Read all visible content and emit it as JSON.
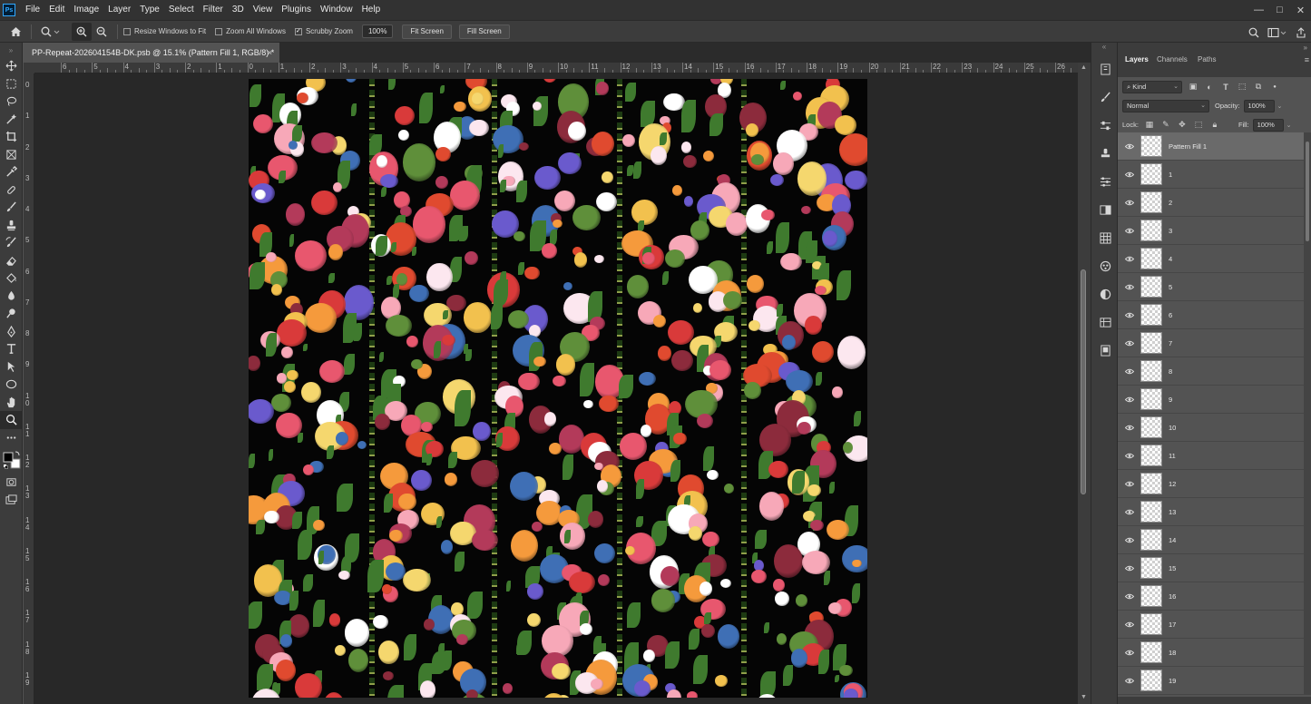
{
  "app": {
    "logo": "Ps",
    "menu": [
      "File",
      "Edit",
      "Image",
      "Layer",
      "Type",
      "Select",
      "Filter",
      "3D",
      "View",
      "Plugins",
      "Window",
      "Help"
    ],
    "window_controls": [
      "—",
      "□",
      "✕"
    ]
  },
  "options_bar": {
    "resize_windows_label": "Resize Windows to Fit",
    "zoom_all_label": "Zoom All Windows",
    "scrubby_zoom_label": "Scrubby Zoom",
    "scrubby_checked": "✓",
    "zoom_value": "100%",
    "fit_screen": "Fit Screen",
    "fill_screen": "Fill Screen"
  },
  "document": {
    "tab_title": "PP-Repeat-202604154B-DK.psb @ 15.1% (Pattern Fill 1, RGB/8) *",
    "close": "×"
  },
  "rulers": {
    "top": [
      "6",
      "5",
      "4",
      "3",
      "2",
      "1",
      "0",
      "1",
      "2",
      "3",
      "4",
      "5",
      "6",
      "7",
      "8",
      "9",
      "10",
      "11",
      "12",
      "13",
      "14",
      "15",
      "16",
      "17",
      "18",
      "19",
      "20",
      "21",
      "22",
      "23",
      "24",
      "25",
      "26"
    ],
    "left": [
      "0",
      "1",
      "2",
      "3",
      "4",
      "5",
      "6",
      "7",
      "8",
      "9",
      "10",
      "11",
      "12",
      "13",
      "14",
      "15",
      "16",
      "17",
      "18",
      "19"
    ]
  },
  "layers_panel": {
    "tabs": [
      "Layers",
      "Channels",
      "Paths"
    ],
    "filter_kind": "Kind",
    "blend_mode": "Normal",
    "opacity_label": "Opacity:",
    "opacity_value": "100%",
    "lock_label": "Lock:",
    "fill_label": "Fill:",
    "fill_value": "100%",
    "layers": [
      "Pattern Fill 1",
      "1",
      "2",
      "3",
      "4",
      "5",
      "6",
      "7",
      "8",
      "9",
      "10",
      "11",
      "12",
      "13",
      "14",
      "15",
      "16",
      "17",
      "18",
      "19"
    ]
  }
}
